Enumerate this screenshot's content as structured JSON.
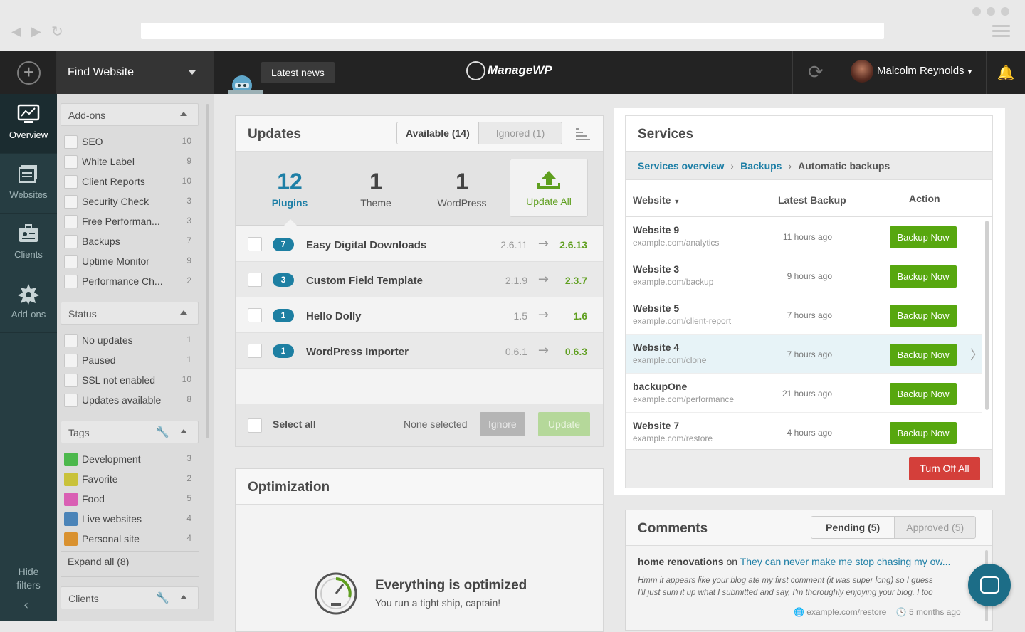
{
  "browser": {
    "back_icon": "back-arrow-icon",
    "forward_icon": "forward-arrow-icon",
    "reload_icon": "reload-icon"
  },
  "topbar": {
    "find_website": "Find Website",
    "latest_news": "Latest news",
    "logo_text": "ManageWP",
    "user_name": "Malcolm Reynolds"
  },
  "leftnav": {
    "items": [
      {
        "label": "Overview",
        "icon": "chart-monitor-icon"
      },
      {
        "label": "Websites",
        "icon": "websites-icon"
      },
      {
        "label": "Clients",
        "icon": "clients-icon"
      },
      {
        "label": "Add-ons",
        "icon": "addons-icon"
      }
    ],
    "hide_filters": "Hide filters"
  },
  "filters": {
    "addons": {
      "title": "Add-ons",
      "items": [
        {
          "label": "SEO",
          "count": "10"
        },
        {
          "label": "White Label",
          "count": "9"
        },
        {
          "label": "Client Reports",
          "count": "10"
        },
        {
          "label": "Security Check",
          "count": "3"
        },
        {
          "label": "Free Performan...",
          "count": "3"
        },
        {
          "label": "Backups",
          "count": "7"
        },
        {
          "label": "Uptime Monitor",
          "count": "9"
        },
        {
          "label": "Performance Ch...",
          "count": "2"
        }
      ]
    },
    "status": {
      "title": "Status",
      "items": [
        {
          "label": "No updates",
          "count": "1"
        },
        {
          "label": "Paused",
          "count": "1"
        },
        {
          "label": "SSL not enabled",
          "count": "10"
        },
        {
          "label": "Updates available",
          "count": "8"
        }
      ]
    },
    "tags": {
      "title": "Tags",
      "items": [
        {
          "label": "Development",
          "count": "3",
          "color": "#4cb84c"
        },
        {
          "label": "Favorite",
          "count": "2",
          "color": "#c9c23a"
        },
        {
          "label": "Food",
          "count": "5",
          "color": "#d95fb4"
        },
        {
          "label": "Live websites",
          "count": "4",
          "color": "#4b84b8"
        },
        {
          "label": "Personal site",
          "count": "4",
          "color": "#d9912f"
        }
      ],
      "expand_all": "Expand all (8)"
    },
    "clients": {
      "title": "Clients"
    }
  },
  "updates": {
    "title": "Updates",
    "tabs": [
      "Available (14)",
      "Ignored (1)"
    ],
    "stats": [
      {
        "num": "12",
        "label": "Plugins"
      },
      {
        "num": "1",
        "label": "Theme"
      },
      {
        "num": "1",
        "label": "WordPress"
      }
    ],
    "update_all": "Update All",
    "rows": [
      {
        "count": "7",
        "name": "Easy Digital Downloads",
        "old": "2.6.11",
        "new": "2.6.13"
      },
      {
        "count": "3",
        "name": "Custom Field Template",
        "old": "2.1.9",
        "new": "2.3.7"
      },
      {
        "count": "1",
        "name": "Hello Dolly",
        "old": "1.5",
        "new": "1.6"
      },
      {
        "count": "1",
        "name": "WordPress Importer",
        "old": "0.6.1",
        "new": "0.6.3"
      }
    ],
    "select_all": "Select all",
    "none_selected": "None selected",
    "ignore": "Ignore",
    "update": "Update"
  },
  "optimization": {
    "title": "Optimization",
    "headline": "Everything is optimized",
    "sub": "You run a tight ship, captain!"
  },
  "services": {
    "title": "Services",
    "crumbs": [
      "Services overview",
      "Backups",
      "Automatic backups"
    ],
    "cols": [
      "Website",
      "Latest Backup",
      "Action"
    ],
    "rows": [
      {
        "name": "Website 9",
        "url": "example.com/analytics",
        "time": "11 hours ago",
        "action": "Backup Now"
      },
      {
        "name": "Website 3",
        "url": "example.com/backup",
        "time": "9 hours ago",
        "action": "Backup Now"
      },
      {
        "name": "Website 5",
        "url": "example.com/client-report",
        "time": "7 hours ago",
        "action": "Backup Now"
      },
      {
        "name": "Website 4",
        "url": "example.com/clone",
        "time": "7 hours ago",
        "action": "Backup Now"
      },
      {
        "name": "backupOne",
        "url": "example.com/performance",
        "time": "21 hours ago",
        "action": "Backup Now"
      },
      {
        "name": "Website 7",
        "url": "example.com/restore",
        "time": "4 hours ago",
        "action": "Backup Now"
      }
    ],
    "turn_off_all": "Turn Off All"
  },
  "comments": {
    "title": "Comments",
    "tabs": [
      "Pending (5)",
      "Approved (5)"
    ],
    "author": "home renovations",
    "on": "on",
    "post": "They can never make me stop chasing my ow...",
    "text1": "Hmm it appears like your blog ate my first comment (it was super long) so I guess",
    "text2": "I'll just sum it up what I submitted and say, I'm thoroughly enjoying your blog. I too",
    "url": "example.com/restore",
    "ago": "5 months ago"
  }
}
